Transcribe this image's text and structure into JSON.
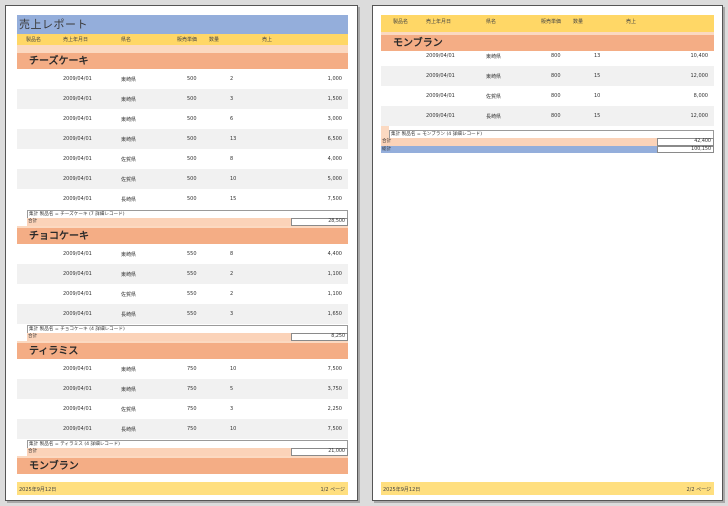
{
  "report_title": "売上レポート",
  "columns": {
    "product": "製品名",
    "date": "売上年月日",
    "prefecture": "県名",
    "unit_price": "販売単価",
    "quantity": "数量",
    "sales": "売上"
  },
  "groups": [
    {
      "name": "チーズケーキ",
      "rows": [
        {
          "date": "2009/04/01",
          "pref": "東崎県",
          "price": "500",
          "qty": "2",
          "sales": "1,000"
        },
        {
          "date": "2009/04/01",
          "pref": "東崎県",
          "price": "500",
          "qty": "3",
          "sales": "1,500"
        },
        {
          "date": "2009/04/01",
          "pref": "東崎県",
          "price": "500",
          "qty": "6",
          "sales": "3,000"
        },
        {
          "date": "2009/04/01",
          "pref": "東崎県",
          "price": "500",
          "qty": "13",
          "sales": "6,500"
        },
        {
          "date": "2009/04/01",
          "pref": "佐賀県",
          "price": "500",
          "qty": "8",
          "sales": "4,000"
        },
        {
          "date": "2009/04/01",
          "pref": "佐賀県",
          "price": "500",
          "qty": "10",
          "sales": "5,000"
        },
        {
          "date": "2009/04/01",
          "pref": "長崎県",
          "price": "500",
          "qty": "15",
          "sales": "7,500"
        }
      ],
      "summary": "集計 製品名 = チーズケーキ (7 詳細レコード)",
      "total_label": "合計",
      "total": "28,500"
    },
    {
      "name": "チョコケーキ",
      "rows": [
        {
          "date": "2009/04/01",
          "pref": "東崎県",
          "price": "550",
          "qty": "8",
          "sales": "4,400"
        },
        {
          "date": "2009/04/01",
          "pref": "東崎県",
          "price": "550",
          "qty": "2",
          "sales": "1,100"
        },
        {
          "date": "2009/04/01",
          "pref": "佐賀県",
          "price": "550",
          "qty": "2",
          "sales": "1,100"
        },
        {
          "date": "2009/04/01",
          "pref": "長崎県",
          "price": "550",
          "qty": "3",
          "sales": "1,650"
        }
      ],
      "summary": "集計 製品名 = チョコケーキ (4 詳細レコード)",
      "total_label": "合計",
      "total": "8,250"
    },
    {
      "name": "ティラミス",
      "rows": [
        {
          "date": "2009/04/01",
          "pref": "東崎県",
          "price": "750",
          "qty": "10",
          "sales": "7,500"
        },
        {
          "date": "2009/04/01",
          "pref": "東崎県",
          "price": "750",
          "qty": "5",
          "sales": "3,750"
        },
        {
          "date": "2009/04/01",
          "pref": "佐賀県",
          "price": "750",
          "qty": "3",
          "sales": "2,250"
        },
        {
          "date": "2009/04/01",
          "pref": "長崎県",
          "price": "750",
          "qty": "10",
          "sales": "7,500"
        }
      ],
      "summary": "集計 製品名 = ティラミス (4 詳細レコード)",
      "total_label": "合計",
      "total": "21,000"
    },
    {
      "name": "モンブラン",
      "rows": [
        {
          "date": "2009/04/01",
          "pref": "東崎県",
          "price": "800",
          "qty": "13",
          "sales": "10,400"
        },
        {
          "date": "2009/04/01",
          "pref": "東崎県",
          "price": "800",
          "qty": "15",
          "sales": "12,000"
        },
        {
          "date": "2009/04/01",
          "pref": "佐賀県",
          "price": "800",
          "qty": "10",
          "sales": "8,000"
        },
        {
          "date": "2009/04/01",
          "pref": "長崎県",
          "price": "800",
          "qty": "15",
          "sales": "12,000"
        }
      ],
      "summary": "集計 製品名 = モンブラン (4 詳細レコード)",
      "total_label": "合計",
      "total": "42,400"
    }
  ],
  "grand_total_label": "総計",
  "grand_total": "100,150",
  "footer": {
    "date": "2025年9月12日",
    "page1": "1/2 ページ",
    "page2": "2/2 ページ"
  },
  "colors": {
    "title_band": "#94aedb",
    "column_header": "#ffd766",
    "group_header": "#f4ad85",
    "total_band": "#fbd3b9",
    "footer": "#ffdf7f"
  }
}
